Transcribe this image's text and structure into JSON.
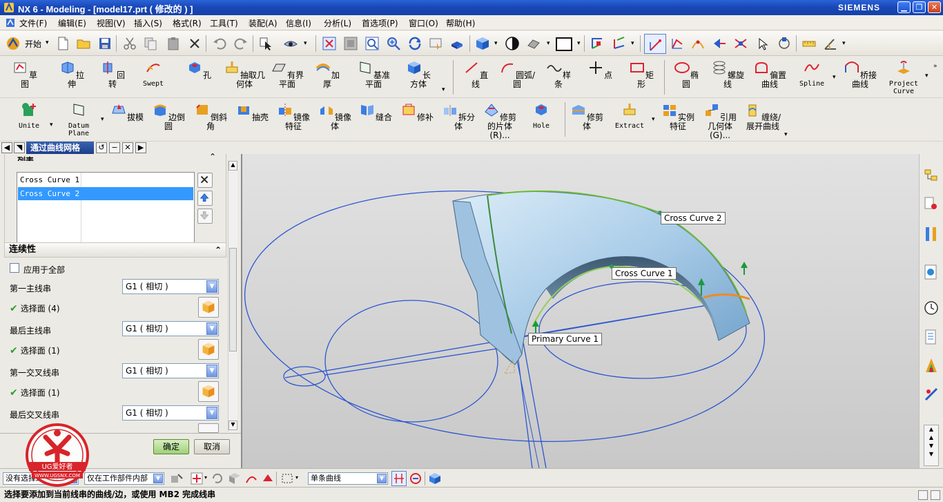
{
  "window": {
    "title": "NX 6 - Modeling - [model17.prt  ( 修改的 ) ]",
    "brand": "SIEMENS"
  },
  "menu": [
    "文件(F)",
    "编辑(E)",
    "视图(V)",
    "插入(S)",
    "格式(R)",
    "工具(T)",
    "装配(A)",
    "信息(I)",
    "分析(L)",
    "首选项(P)",
    "窗口(O)",
    "帮助(H)"
  ],
  "toolbar1": {
    "start_label": "开始"
  },
  "toolbar2": [
    "草图",
    "拉伸",
    "回转",
    "Swept",
    "孔",
    "抽取几何体",
    "有界平面",
    "加厚",
    "基准平面",
    "长方体",
    "直线",
    "圆弧/圆",
    "样条",
    "点",
    "矩形",
    "椭圆",
    "螺旋线",
    "偏置曲线",
    "Spline",
    "桥接曲线",
    "Project Curve"
  ],
  "toolbar3": [
    "Unite",
    "Datum Plane",
    "拔模",
    "边倒圆",
    "倒斜角",
    "抽壳",
    "镜像特征",
    "镜像体",
    "缝合",
    "修补",
    "拆分体",
    "修剪的片体(R)...",
    "Hole",
    "修剪体",
    "Extract",
    "实例特征",
    "引用几何体(G)...",
    "缠绕/展开曲线"
  ],
  "dialog": {
    "title": "通过曲线网格",
    "list_section": "列表",
    "list_items": [
      "Cross Curve  1",
      "Cross Curve  2"
    ],
    "continuity_section": "连续性",
    "apply_all": "应用于全部",
    "rows": [
      {
        "label": "第一主线串",
        "value": "G1 ( 相切 )",
        "status": "选择面 (4)"
      },
      {
        "label": "最后主线串",
        "value": "G1 ( 相切 )",
        "status": "选择面 (1)"
      },
      {
        "label": "第一交叉线串",
        "value": "G1 ( 相切 )",
        "status": "选择面 (1)"
      },
      {
        "label": "最后交叉线串",
        "value": "G1 ( 相切 )",
        "status": ""
      }
    ],
    "ok": "确定",
    "cancel": "取消"
  },
  "viewport": {
    "callouts": [
      "Cross Curve  2",
      "Cross Curve  1",
      "Primary Curve  1"
    ]
  },
  "statusbar": {
    "filter": "没有选择过滤器",
    "scope": "仅在工作部件内部",
    "curve_rule": "单条曲线"
  },
  "prompt": "选择要添加到当前线串的曲线/边，或使用 MB2 完成线串",
  "watermark": {
    "brand": "UG爱好者",
    "url": "WWW.UGSNX.COM"
  }
}
